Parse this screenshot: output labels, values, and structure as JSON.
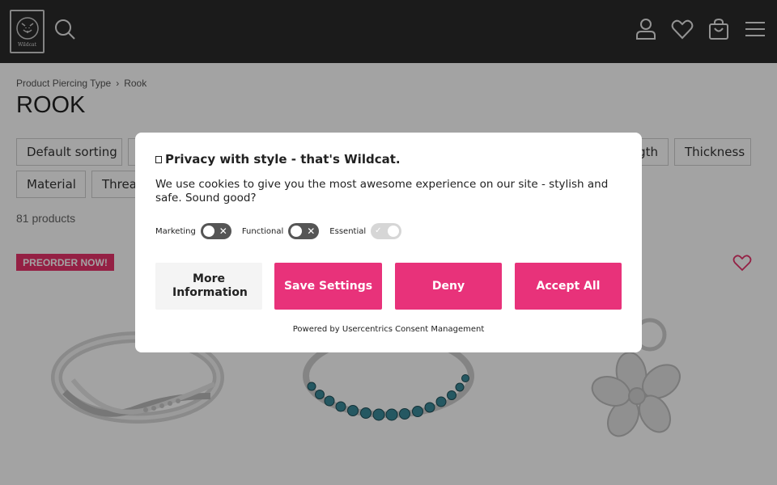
{
  "header": {
    "logo_text": "Wildcat",
    "icons": [
      "search-icon",
      "user-icon",
      "heart-icon",
      "shopping-bag-icon",
      "menu-icon"
    ],
    "background": "#2b2b2b"
  },
  "breadcrumb": {
    "items": [
      "Product Piercing Type",
      "Rook"
    ],
    "separator": "›"
  },
  "page_title": "ROOK",
  "filters": {
    "row1": [
      "Default sorting",
      "",
      "ngth",
      "Thickness"
    ],
    "row2": [
      "Material",
      "Threa"
    ]
  },
  "product_count": "81 products",
  "products": {
    "badge": "PREORDER NOW!",
    "accent": "#e8326b"
  },
  "consent": {
    "title": "Privacy with style - that's Wildcat.",
    "text": "We use cookies to give you the most awesome experience on our site - stylish and safe. Sound good?",
    "toggles": [
      {
        "label": "Marketing",
        "state": "off"
      },
      {
        "label": "Functional",
        "state": "off"
      },
      {
        "label": "Essential",
        "state": "on-disabled"
      }
    ],
    "buttons": {
      "more_info": "More Information",
      "save": "Save Settings",
      "deny": "Deny",
      "accept": "Accept All"
    },
    "powered_by": "Powered by Usercentrics Consent Management",
    "button_color": "#e8327a"
  }
}
